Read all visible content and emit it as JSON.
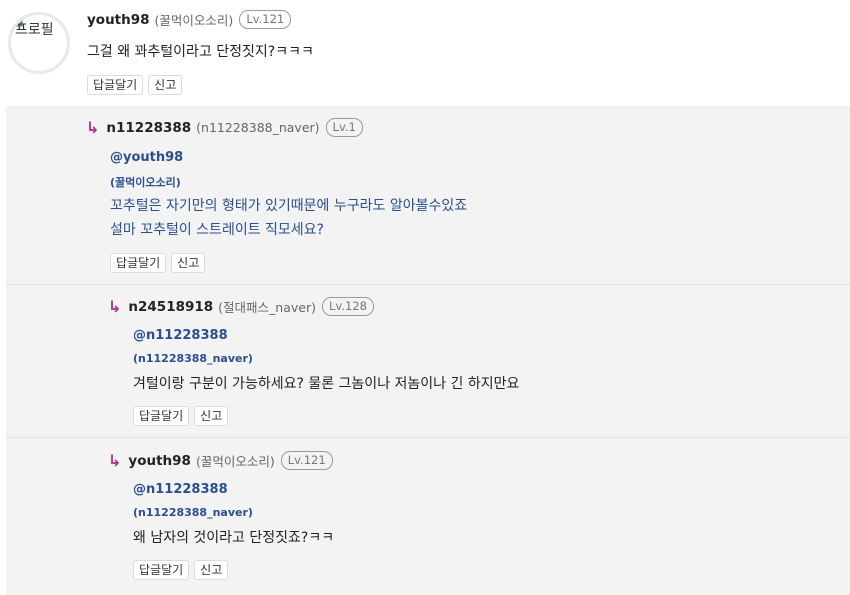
{
  "comments": [
    {
      "nickname": "youth98",
      "sub": "(꿀먹이오소리)",
      "level": "Lv.121",
      "avatar_alt": "프로필",
      "text": "그걸 왜 꽈추털이라고 단정짓지?ㅋㅋㅋ",
      "reply_label": "답글달기",
      "report_label": "신고"
    },
    {
      "nickname": "n11228388",
      "sub": "(n11228388_naver)",
      "level": "Lv.1",
      "mention": "@youth98",
      "mention_sub": "(꿀먹이오소리)",
      "text_lines": [
        "꼬추털은 자기만의 형태가 있기때문에 누구라도 알아볼수있죠",
        "설마 꼬추털이 스트레이트 직모세요?"
      ],
      "reply_label": "답글달기",
      "report_label": "신고"
    },
    {
      "nickname": "n24518918",
      "sub": "(절대패스_naver)",
      "level": "Lv.128",
      "mention": "@n11228388",
      "mention_sub": "(n11228388_naver)",
      "text": "겨털이랑 구분이 가능하세요? 물론 그놈이나 저놈이나 긴 하지만요",
      "reply_label": "답글달기",
      "report_label": "신고"
    },
    {
      "nickname": "youth98",
      "sub": "(꿀먹이오소리)",
      "level": "Lv.121",
      "mention": "@n11228388",
      "mention_sub": "(n11228388_naver)",
      "text": "왜 남자의 것이라고 단정짓죠?ㅋㅋ",
      "reply_label": "답글달기",
      "report_label": "신고"
    }
  ],
  "colors": {
    "reply_bg": "#f3f3f3",
    "mention": "#2a4e8f",
    "reply_arrow": "#b3328f"
  },
  "icons": {
    "reply_arrow": "reply-arrow-icon",
    "broken_image": "broken-image-icon"
  }
}
